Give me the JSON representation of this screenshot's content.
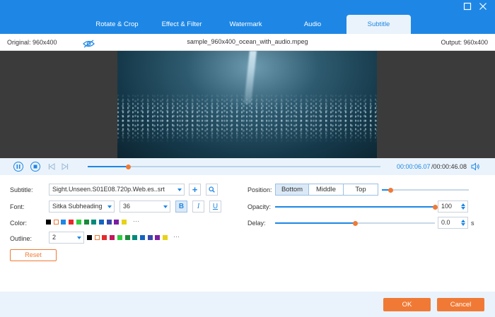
{
  "tabs": [
    {
      "label": "Rotate & Crop"
    },
    {
      "label": "Effect & Filter"
    },
    {
      "label": "Watermark"
    },
    {
      "label": "Audio"
    },
    {
      "label": "Subtitle"
    }
  ],
  "active_tab": "Subtitle",
  "info": {
    "original": "Original: 960x400",
    "filename": "sample_960x400_ocean_with_audio.mpeg",
    "output": "Output: 960x400"
  },
  "player": {
    "current_time": "00:00:06.07",
    "total_time": "/00:00:46.08",
    "progress": 0.14
  },
  "subtitle": {
    "label": "Subtitle:",
    "file": "Sight.Unseen.S01E08.720p.Web.es..srt"
  },
  "font": {
    "label": "Font:",
    "family": "Sitka Subheading",
    "size": "36",
    "bold": "B",
    "italic": "I",
    "underline": "U"
  },
  "color": {
    "label": "Color:",
    "swatches": [
      "#000000",
      "#ffffff",
      "#1e87e5",
      "#e52a2a",
      "#2ecc40",
      "#1a8a3a",
      "#00897b",
      "#1565c0",
      "#3949ab",
      "#7b1fa2",
      "#e6d21a"
    ],
    "more": "···"
  },
  "outline": {
    "label": "Outline:",
    "value": "2",
    "swatches": [
      "#000000",
      "#ffffff",
      "#e52a2a",
      "#c2185b",
      "#2ecc40",
      "#1a8a3a",
      "#00897b",
      "#1565c0",
      "#3949ab",
      "#7b1fa2",
      "#e6d21a"
    ],
    "more": "···"
  },
  "position": {
    "label": "Position:",
    "options": [
      "Bottom",
      "Middle",
      "Top"
    ],
    "selected": "Bottom",
    "slider": 0.1
  },
  "opacity": {
    "label": "Opacity:",
    "value": "100",
    "slider": 1.0
  },
  "delay": {
    "label": "Delay:",
    "value": "0.0",
    "unit": "s",
    "slider": 0.5
  },
  "buttons": {
    "reset": "Reset",
    "ok": "OK",
    "cancel": "Cancel"
  },
  "colors": {
    "accent": "#1e87e5",
    "orange": "#f07a35"
  }
}
